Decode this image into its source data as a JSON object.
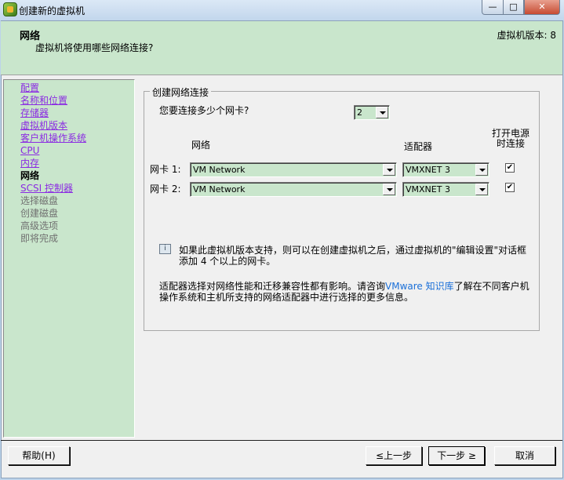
{
  "window": {
    "title": "创建新的虚拟机",
    "minimize": "—",
    "maximize": "□",
    "close": "✕"
  },
  "header": {
    "title": "网络",
    "subtitle": "虚拟机将使用哪些网络连接?",
    "version": "虚拟机版本: 8"
  },
  "sidebar": {
    "items": [
      {
        "label": "配置",
        "state": "link"
      },
      {
        "label": "名称和位置",
        "state": "link"
      },
      {
        "label": "存储器",
        "state": "link"
      },
      {
        "label": "虚拟机版本",
        "state": "link"
      },
      {
        "label": "客户机操作系统",
        "state": "link"
      },
      {
        "label": "CPU",
        "state": "link"
      },
      {
        "label": "内存",
        "state": "link"
      },
      {
        "label": "网络",
        "state": "current"
      },
      {
        "label": "SCSI 控制器",
        "state": "link"
      },
      {
        "label": "选择磁盘",
        "state": "disabled"
      },
      {
        "label": "创建磁盘",
        "state": "disabled"
      },
      {
        "label": "高级选项",
        "state": "disabled"
      },
      {
        "label": "即将完成",
        "state": "disabled"
      }
    ]
  },
  "group": {
    "title": "创建网络连接",
    "nic_count_label": "您要连接多少个网卡?",
    "nic_count": "2",
    "col_network": "网络",
    "col_adapter": "适配器",
    "col_connect": "打开电源\n时连接",
    "nics": [
      {
        "label": "网卡 1:",
        "network": "VM Network",
        "adapter": "VMXNET 3",
        "connect": true
      },
      {
        "label": "网卡 2:",
        "network": "VM Network",
        "adapter": "VMXNET 3",
        "connect": true
      }
    ],
    "info_text": "如果此虚拟机版本支持，则可以在创建虚拟机之后，通过虚拟机的\"编辑设置\"对话框添加 4 个以上的网卡。",
    "note_pre": "适配器选择对网络性能和迁移兼容性都有影响。请咨询",
    "note_link": "VMware 知识库",
    "note_post": "了解在不同客户机操作系统和主机所支持的网络适配器中进行选择的更多信息。"
  },
  "footer": {
    "help": "帮助(H)",
    "back": "≤上一步",
    "next": "下一步 ≥",
    "cancel": "取消"
  }
}
